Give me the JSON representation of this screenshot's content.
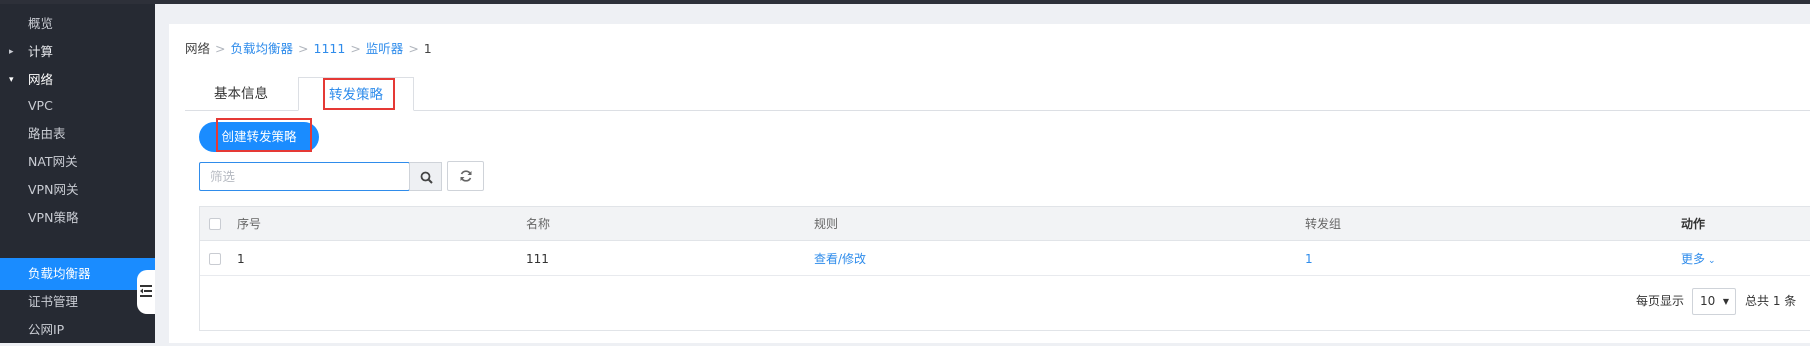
{
  "sidebar": {
    "items": [
      {
        "label": "概览"
      },
      {
        "label": "计算"
      },
      {
        "label": "网络"
      },
      {
        "label": "VPC"
      },
      {
        "label": "路由表"
      },
      {
        "label": "NAT网关"
      },
      {
        "label": "VPN网关"
      },
      {
        "label": "VPN策略"
      },
      {
        "label": "负载均衡器"
      },
      {
        "label": "证书管理"
      },
      {
        "label": "公网IP"
      }
    ],
    "caret_collapsed": "▸",
    "caret_expanded": "▾"
  },
  "breadcrumb": {
    "items": [
      "网络",
      "负载均衡器",
      "1111",
      "监听器",
      "1"
    ],
    "separator": ">"
  },
  "tabs": [
    {
      "label": "基本信息"
    },
    {
      "label": "转发策略"
    }
  ],
  "toolbar": {
    "create_label": "创建转发策略",
    "search_placeholder": "筛选",
    "search_value": ""
  },
  "table": {
    "columns": [
      "序号",
      "名称",
      "规则",
      "转发组",
      "动作"
    ],
    "rows": [
      {
        "index": "1",
        "name": "111",
        "rule": "查看/修改",
        "group": "1",
        "action": "更多"
      }
    ]
  },
  "pagination": {
    "per_page_label": "每页显示",
    "per_page_value": "10",
    "total_label": "总共 1 条"
  },
  "colors": {
    "accent": "#1a8cff",
    "link": "#2f8ceb",
    "sidebar_bg": "#262a33",
    "highlight": "#e53935"
  }
}
